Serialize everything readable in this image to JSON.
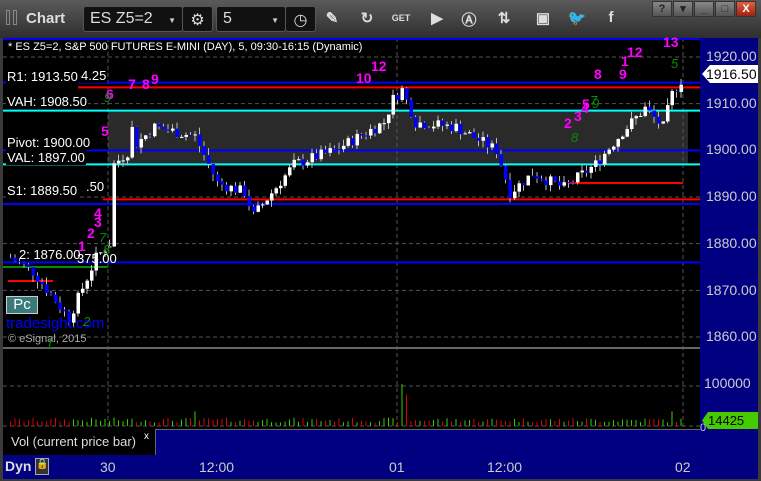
{
  "window": {
    "title": "Chart",
    "symbol": "ES Z5=2",
    "interval": "5",
    "help": "?",
    "minimize": "_",
    "maximize": "□",
    "close": "X"
  },
  "toolbar_icons": [
    "settings-icon",
    "clock-icon",
    "pencil-icon",
    "refresh-icon",
    "get-icon",
    "play-icon",
    "alert-icon",
    "link-icon",
    "comment-icon",
    "twitter-icon",
    "facebook-icon"
  ],
  "chart": {
    "header": "* ES Z5=2, S&P 500 FUTURES E-MINI (DAY), 5, 09:30-16:15 (Dynamic)",
    "levels": {
      "r1": "R1: 1913.50",
      "r1_extra": "4.25",
      "vah": "VAH: 1908.50",
      "pivot": "Pivot: 1900.00",
      "val": "VAL: 1897.00",
      "s1": "S1: 1889.50",
      "s1_extra": ".50",
      "s2": "2: 1876.00",
      "s2_extra": "375.00"
    },
    "price_labels": [
      "1920.00",
      "1910.00",
      "1900.00",
      "1890.00",
      "1880.00",
      "1870.00",
      "1860.00"
    ],
    "current_price": "1916.50",
    "pc_label": "Pc",
    "watermark": "tradesight.com",
    "copyright": "© eSignal, 2015",
    "counts_magenta": [
      "1",
      "2",
      "3",
      "4",
      "5",
      "6",
      "7",
      "8",
      "9",
      "10",
      "12",
      "2",
      "3",
      "4",
      "5",
      "8",
      "9",
      "1",
      "12",
      "13"
    ],
    "counts_green": [
      "7",
      "8",
      "9",
      "2",
      "1",
      "7",
      "8",
      "9",
      "5"
    ],
    "colors": {
      "up": "#ffffff",
      "down": "#0000ff",
      "r1": "#ff0000",
      "pivot": "#0000ff",
      "va": "#00ffff",
      "vol_up": "#33cc00",
      "vol_down": "#dd0000"
    }
  },
  "chart_data": {
    "type": "candlestick",
    "waypoints": [
      [
        0,
        1877
      ],
      [
        5,
        1874
      ],
      [
        13,
        1864
      ],
      [
        19,
        1877
      ],
      [
        22,
        1880
      ],
      [
        23,
        1897
      ],
      [
        32,
        1905
      ],
      [
        41,
        1903
      ],
      [
        46,
        1893
      ],
      [
        52,
        1891
      ],
      [
        54,
        1886
      ],
      [
        63,
        1897
      ],
      [
        72,
        1900
      ],
      [
        83,
        1906
      ],
      [
        85,
        1911
      ],
      [
        87,
        1913
      ],
      [
        90,
        1906
      ],
      [
        99,
        1905
      ],
      [
        108,
        1900
      ],
      [
        111,
        1891
      ],
      [
        116,
        1895
      ],
      [
        123,
        1892
      ],
      [
        130,
        1897
      ],
      [
        136,
        1904
      ],
      [
        141,
        1909
      ],
      [
        145,
        1905
      ],
      [
        147,
        1912
      ],
      [
        150,
        1916.5
      ]
    ],
    "ylim": [
      1857,
      1924
    ]
  },
  "volume": {
    "label": "Vol (current price bar)",
    "close": "x",
    "axis": [
      "100000",
      "0"
    ],
    "current": "14425"
  },
  "time_axis": {
    "dyn": "Dyn",
    "labels": [
      "30",
      "12:00",
      "01",
      "12:00",
      "02"
    ]
  }
}
